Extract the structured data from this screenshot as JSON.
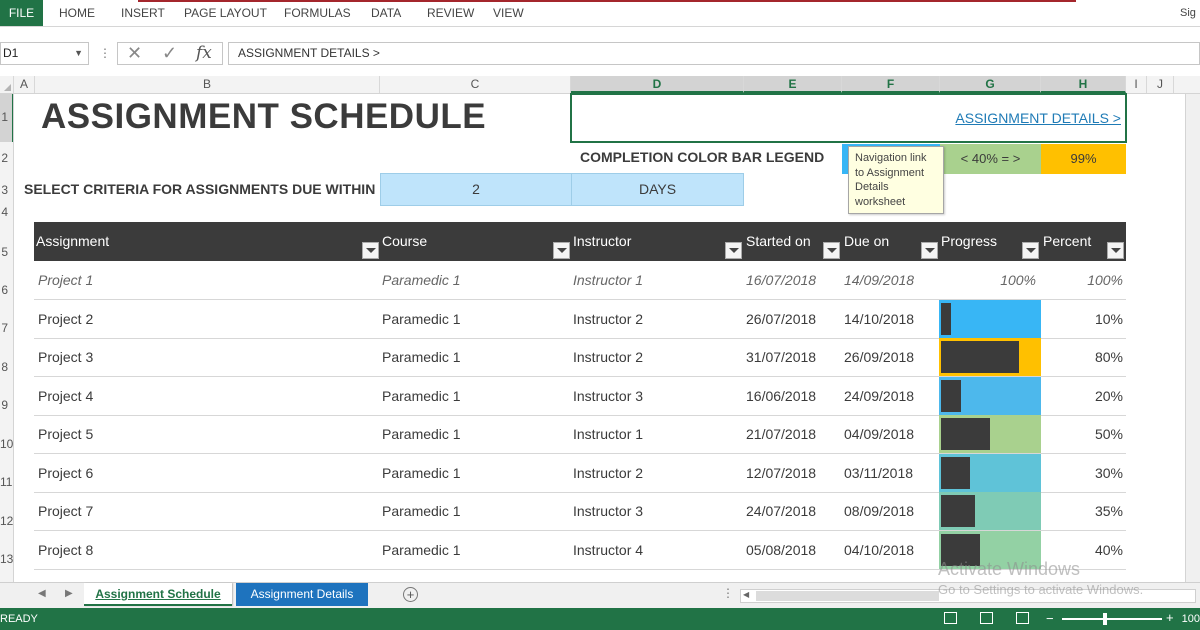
{
  "ribbon": {
    "file_label": "FILE",
    "tabs": [
      "HOME",
      "INSERT",
      "PAGE LAYOUT",
      "FORMULAS",
      "DATA",
      "REVIEW",
      "VIEW"
    ],
    "signin": "Sig"
  },
  "formula_bar": {
    "name_box": "D1",
    "formula": "ASSIGNMENT DETAILS >"
  },
  "columns": [
    "A",
    "B",
    "C",
    "D",
    "E",
    "F",
    "G",
    "H",
    "I",
    "J"
  ],
  "rows": [
    "1",
    "2",
    "3",
    "4",
    "5",
    "6",
    "7",
    "8",
    "9",
    "10",
    "11",
    "12",
    "13"
  ],
  "sheet": {
    "title": "ASSIGNMENT SCHEDULE",
    "details_link": "ASSIGNMENT DETAILS >",
    "legend_label": "COMPLETION COLOR BAR LEGEND",
    "legend_mid": "< 40% = >",
    "legend_high": "99%",
    "tooltip": "Navigation link to Assignment Details worksheet",
    "criteria_label": "SELECT CRITERIA FOR ASSIGNMENTS DUE WITHIN",
    "criteria_value": "2",
    "criteria_unit": "DAYS"
  },
  "colors": {
    "legend_low": "#38b6f5",
    "legend_mid": "#a9d18e",
    "legend_high": "#ffc000",
    "accent": "#217346"
  },
  "table": {
    "headers": [
      "Assignment",
      "Course",
      "Instructor",
      "Started on",
      "Due on",
      "Progress",
      "Percent"
    ],
    "rows": [
      {
        "assignment": "Project 1",
        "course": "Paramedic 1",
        "instructor": "Instructor 1",
        "started": "16/07/2018",
        "due": "14/09/2018",
        "progress": "100%",
        "percent": "100%"
      },
      {
        "assignment": "Project 2",
        "course": "Paramedic 1",
        "instructor": "Instructor 2",
        "started": "26/07/2018",
        "due": "14/10/2018",
        "progress": "",
        "percent": "10%"
      },
      {
        "assignment": "Project 3",
        "course": "Paramedic 1",
        "instructor": "Instructor 2",
        "started": "31/07/2018",
        "due": "26/09/2018",
        "progress": "",
        "percent": "80%"
      },
      {
        "assignment": "Project 4",
        "course": "Paramedic 1",
        "instructor": "Instructor 3",
        "started": "16/06/2018",
        "due": "24/09/2018",
        "progress": "",
        "percent": "20%"
      },
      {
        "assignment": "Project 5",
        "course": "Paramedic 1",
        "instructor": "Instructor 1",
        "started": "21/07/2018",
        "due": "04/09/2018",
        "progress": "",
        "percent": "50%"
      },
      {
        "assignment": "Project 6",
        "course": "Paramedic 1",
        "instructor": "Instructor 2",
        "started": "12/07/2018",
        "due": "03/11/2018",
        "progress": "",
        "percent": "30%"
      },
      {
        "assignment": "Project 7",
        "course": "Paramedic 1",
        "instructor": "Instructor 3",
        "started": "24/07/2018",
        "due": "08/09/2018",
        "progress": "",
        "percent": "35%"
      },
      {
        "assignment": "Project 8",
        "course": "Paramedic 1",
        "instructor": "Instructor 4",
        "started": "05/08/2018",
        "due": "04/10/2018",
        "progress": "",
        "percent": "40%"
      }
    ],
    "progress_values": [
      1.0,
      0.1,
      0.8,
      0.2,
      0.5,
      0.3,
      0.35,
      0.4
    ],
    "progress_bg_colors": [
      "#ffffff",
      "#38b6f5",
      "#ffc000",
      "#4db8ec",
      "#a9d18e",
      "#5fc3d8",
      "#7fcbb5",
      "#93d1a4"
    ]
  },
  "sheet_tabs": [
    "Assignment Schedule",
    "Assignment Details"
  ],
  "status": {
    "ready": "READY",
    "zoom": "100"
  },
  "watermark": {
    "line1": "Activate Windows",
    "line2": "Go to Settings to activate Windows."
  }
}
